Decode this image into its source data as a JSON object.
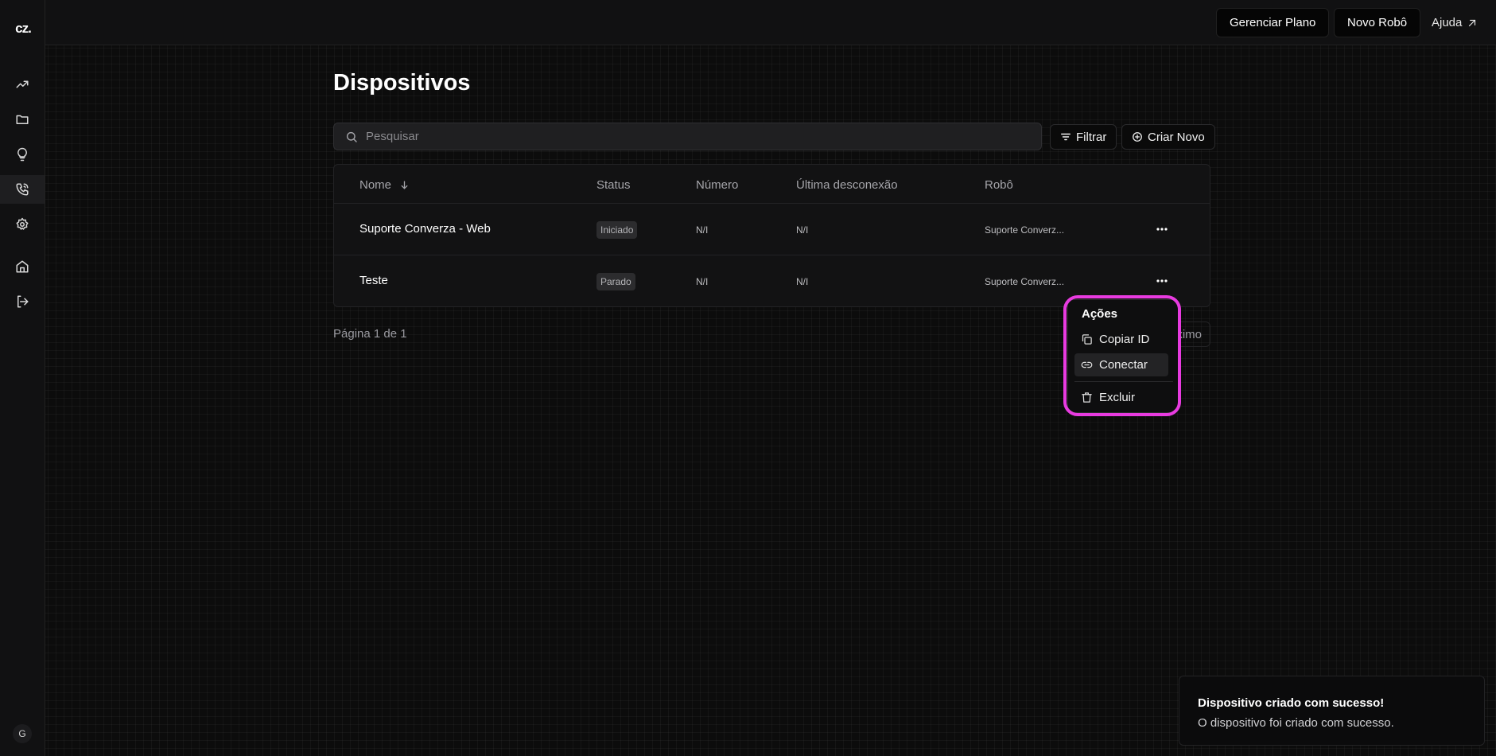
{
  "brand": {
    "logo_text": "cz."
  },
  "sidebar": {
    "items": [
      {
        "name": "trending-icon"
      },
      {
        "name": "folder-icon"
      },
      {
        "name": "lightbulb-icon"
      },
      {
        "name": "phone-icon"
      },
      {
        "name": "gear-icon"
      },
      {
        "name": "home-icon"
      },
      {
        "name": "logout-icon"
      }
    ],
    "avatar_initial": "G"
  },
  "topbar": {
    "manage_plan_label": "Gerenciar Plano",
    "new_robot_label": "Novo Robô",
    "help_label": "Ajuda"
  },
  "page": {
    "title": "Dispositivos"
  },
  "search": {
    "placeholder": "Pesquisar",
    "value": ""
  },
  "toolbar": {
    "filter_label": "Filtrar",
    "create_label": "Criar Novo"
  },
  "table": {
    "headers": {
      "name": "Nome",
      "status": "Status",
      "number": "Número",
      "last_disconnect": "Última desconexão",
      "robot": "Robô"
    },
    "rows": [
      {
        "name": "Suporte Converza - Web",
        "status": "Iniciado",
        "number": "N/I",
        "last_disconnect": "N/I",
        "robot": "Suporte Converz..."
      },
      {
        "name": "Teste",
        "status": "Parado",
        "number": "N/I",
        "last_disconnect": "N/I",
        "robot": "Suporte Converz..."
      }
    ]
  },
  "pagination": {
    "label": "Página 1 de 1",
    "next_label_visible": "ximo"
  },
  "menu": {
    "title": "Ações",
    "items": [
      {
        "label": "Copiar ID",
        "icon": "copy-icon"
      },
      {
        "label": "Conectar",
        "icon": "link-icon"
      },
      {
        "label": "Excluir",
        "icon": "trash-icon"
      }
    ],
    "highlight_color": "#e83be0"
  },
  "toast": {
    "title": "Dispositivo criado com sucesso!",
    "description": "O dispositivo foi criado com sucesso."
  }
}
